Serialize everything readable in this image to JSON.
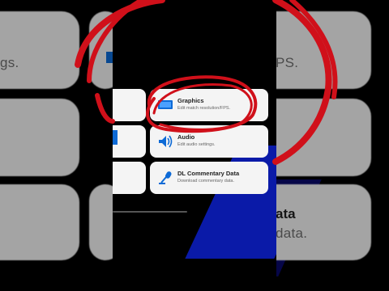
{
  "cards": [
    {
      "title": "Graphics",
      "desc": "Edit match resolution/FPS.",
      "icon": "monitor-icon"
    },
    {
      "title": "Audio",
      "desc": "Edit audio settings.",
      "icon": "speaker-icon"
    },
    {
      "title": "DL Commentary Data",
      "desc": "Download commentary data.",
      "icon": "microphone-icon"
    }
  ],
  "background": {
    "left_top_fragment": "gs.",
    "right_top_fragment": "PS.",
    "right_bottom_title": "ata",
    "right_bottom_fragment": "data."
  },
  "colors": {
    "accent_blue": "#0d6ad6",
    "scribble_red": "#d0101a",
    "card_bg": "#f4f4f4",
    "navy": "#0a1aa8"
  }
}
